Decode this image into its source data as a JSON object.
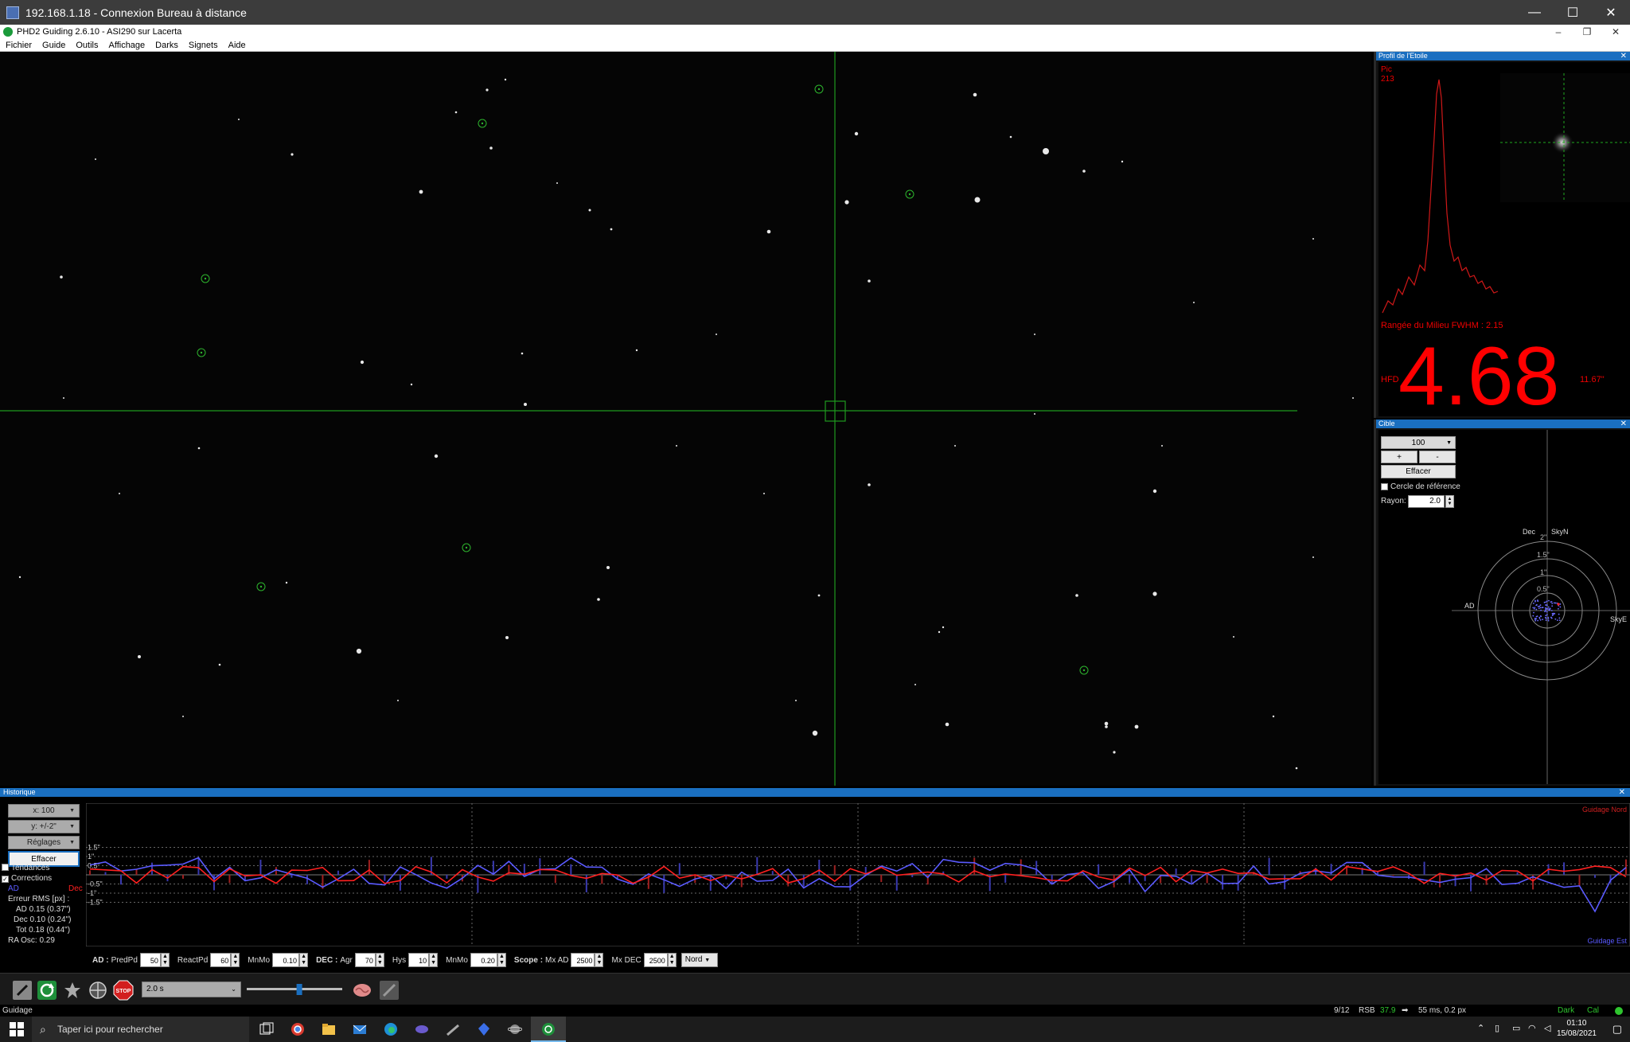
{
  "rdp": {
    "title": "192.168.1.18 - Connexion Bureau à distance",
    "min": "—",
    "max": "☐",
    "close": "✕"
  },
  "app": {
    "title": "PHD2 Guiding 2.6.10 - ASI290 sur Lacerta",
    "min": "–",
    "max": "❐",
    "close": "✕"
  },
  "menu": [
    "Fichier",
    "Guide",
    "Outils",
    "Affichage",
    "Darks",
    "Signets",
    "Aide"
  ],
  "profile": {
    "title": "Profil de l'Etoile",
    "pic_label": "Pic",
    "pic_value": "213",
    "fwhm": "Rangée du Milieu FWHM : 2.15",
    "hfd_label": "HFD",
    "hfd_value": "4.68",
    "hfd_arcsec": "11.67\""
  },
  "target": {
    "title": "Cible",
    "zoom": "100",
    "plus": "+",
    "minus": "-",
    "clear": "Effacer",
    "ref_circle": "Cercle de référence",
    "radius_label": "Rayon:",
    "radius_value": "2.0",
    "dec_label": "Dec",
    "skyn_label": "SkyN",
    "ad_label": "AD",
    "skye_label": "SkyE",
    "ring_labels": [
      "2\"",
      "1.5\"",
      "1\"",
      "0.5\""
    ]
  },
  "history": {
    "title": "Historique",
    "x_scale": "x: 100",
    "y_scale": "y: +/-2\"",
    "settings": "Réglages",
    "clear": "Effacer",
    "trends": "Tendances",
    "corrections": "Corrections",
    "ad_legend": "AD",
    "dec_legend": "Dec",
    "rms_title": "Erreur RMS [px] :",
    "rms_ad": "AD 0.15 (0.37\")",
    "rms_dec": "Dec 0.10 (0.24\")",
    "rms_tot": "Tot 0.18 (0.44\")",
    "ra_osc": "RA Osc: 0.29",
    "y_ticks": [
      "1.5\"",
      "1\"",
      "0.5\"",
      "-0.5\"",
      "-1\"",
      "-1.5\""
    ],
    "north_label": "Guidage Nord",
    "east_label": "Guidage Est",
    "colors": {
      "ra": "#5a5aff",
      "dec": "#ff2020"
    }
  },
  "controls": {
    "ra_label": "AD :",
    "predpd_label": "PredPd",
    "predpd": "50",
    "reactpd_label": "ReactPd",
    "reactpd": "60",
    "mnmo_label": "MnMo",
    "mnmo_ra": "0.10",
    "dec_label": "DEC :",
    "agr_label": "Agr",
    "agr": "70",
    "hys_label": "Hys",
    "hys": "10",
    "mnmo_dec": "0.20",
    "scope_label": "Scope :",
    "mxad_label": "Mx AD",
    "mxad": "2500",
    "mxdec_label": "Mx DEC",
    "mxdec": "2500",
    "direction": "Nord"
  },
  "toolbar": {
    "exposure": "2.0 s",
    "slider_fraction": 0.55,
    "stop_label": "STOP"
  },
  "status": {
    "mode": "Guidage",
    "frames": "9/12",
    "snr_label": "RSB",
    "snr": "37.9",
    "guide_info": "55 ms, 0.2 px",
    "dark": "Dark",
    "cal": "Cal"
  },
  "taskbar": {
    "search": "Taper ici pour rechercher",
    "time": "01:10",
    "date": "15/08/2021"
  }
}
